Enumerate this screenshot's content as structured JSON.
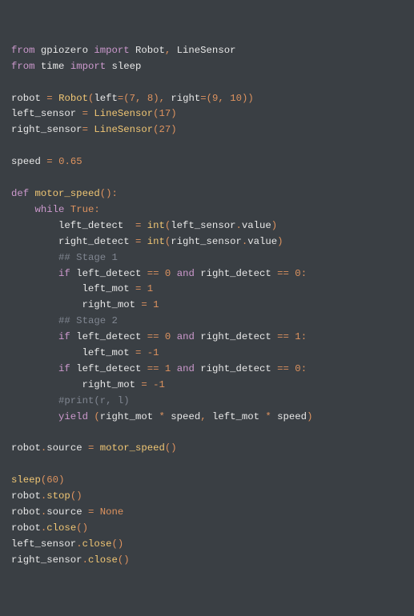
{
  "code": [
    [
      [
        "kw",
        "from"
      ],
      [
        "white",
        " gpiozero "
      ],
      [
        "kw",
        "import"
      ],
      [
        "white",
        " Robot"
      ],
      [
        "num",
        ","
      ],
      [
        "white",
        " LineSensor"
      ]
    ],
    [
      [
        "kw",
        "from"
      ],
      [
        "white",
        " time "
      ],
      [
        "kw",
        "import"
      ],
      [
        "white",
        " sleep"
      ]
    ],
    [
      [
        "",
        ""
      ]
    ],
    [
      [
        "white",
        "robot "
      ],
      [
        "num",
        "="
      ],
      [
        "white",
        " "
      ],
      [
        "fn",
        "Robot"
      ],
      [
        "num",
        "("
      ],
      [
        "white",
        "left"
      ],
      [
        "num",
        "=("
      ],
      [
        "num",
        "7"
      ],
      [
        "num",
        ","
      ],
      [
        "white",
        " "
      ],
      [
        "num",
        "8"
      ],
      [
        "num",
        "),"
      ],
      [
        "white",
        " right"
      ],
      [
        "num",
        "=("
      ],
      [
        "num",
        "9"
      ],
      [
        "num",
        ","
      ],
      [
        "white",
        " "
      ],
      [
        "num",
        "10"
      ],
      [
        "num",
        "))"
      ]
    ],
    [
      [
        "white",
        "left_sensor "
      ],
      [
        "num",
        "="
      ],
      [
        "white",
        " "
      ],
      [
        "fn",
        "LineSensor"
      ],
      [
        "num",
        "("
      ],
      [
        "num",
        "17"
      ],
      [
        "num",
        ")"
      ]
    ],
    [
      [
        "white",
        "right_sensor"
      ],
      [
        "num",
        "="
      ],
      [
        "white",
        " "
      ],
      [
        "fn",
        "LineSensor"
      ],
      [
        "num",
        "("
      ],
      [
        "num",
        "27"
      ],
      [
        "num",
        ")"
      ]
    ],
    [
      [
        "",
        ""
      ]
    ],
    [
      [
        "white",
        "speed "
      ],
      [
        "num",
        "="
      ],
      [
        "white",
        " "
      ],
      [
        "num",
        "0.65"
      ]
    ],
    [
      [
        "",
        ""
      ]
    ],
    [
      [
        "kw",
        "def"
      ],
      [
        "white",
        " "
      ],
      [
        "fn",
        "motor_speed"
      ],
      [
        "num",
        "():"
      ]
    ],
    [
      [
        "white",
        "    "
      ],
      [
        "kw",
        "while"
      ],
      [
        "white",
        " "
      ],
      [
        "num",
        "True"
      ],
      [
        "num",
        ":"
      ]
    ],
    [
      [
        "white",
        "        left_detect  "
      ],
      [
        "num",
        "="
      ],
      [
        "white",
        " "
      ],
      [
        "fn",
        "int"
      ],
      [
        "num",
        "("
      ],
      [
        "white",
        "left_sensor"
      ],
      [
        "num",
        "."
      ],
      [
        "white",
        "value"
      ],
      [
        "num",
        ")"
      ]
    ],
    [
      [
        "white",
        "        right_detect "
      ],
      [
        "num",
        "="
      ],
      [
        "white",
        " "
      ],
      [
        "fn",
        "int"
      ],
      [
        "num",
        "("
      ],
      [
        "white",
        "right_sensor"
      ],
      [
        "num",
        "."
      ],
      [
        "white",
        "value"
      ],
      [
        "num",
        ")"
      ]
    ],
    [
      [
        "white",
        "        "
      ],
      [
        "comment",
        "## Stage 1"
      ]
    ],
    [
      [
        "white",
        "        "
      ],
      [
        "kw",
        "if"
      ],
      [
        "white",
        " left_detect "
      ],
      [
        "num",
        "=="
      ],
      [
        "white",
        " "
      ],
      [
        "num",
        "0"
      ],
      [
        "white",
        " "
      ],
      [
        "kw",
        "and"
      ],
      [
        "white",
        " right_detect "
      ],
      [
        "num",
        "=="
      ],
      [
        "white",
        " "
      ],
      [
        "num",
        "0"
      ],
      [
        "num",
        ":"
      ]
    ],
    [
      [
        "white",
        "            left_mot "
      ],
      [
        "num",
        "="
      ],
      [
        "white",
        " "
      ],
      [
        "num",
        "1"
      ]
    ],
    [
      [
        "white",
        "            right_mot "
      ],
      [
        "num",
        "="
      ],
      [
        "white",
        " "
      ],
      [
        "num",
        "1"
      ]
    ],
    [
      [
        "white",
        "        "
      ],
      [
        "comment",
        "## Stage 2"
      ]
    ],
    [
      [
        "white",
        "        "
      ],
      [
        "kw",
        "if"
      ],
      [
        "white",
        " left_detect "
      ],
      [
        "num",
        "=="
      ],
      [
        "white",
        " "
      ],
      [
        "num",
        "0"
      ],
      [
        "white",
        " "
      ],
      [
        "kw",
        "and"
      ],
      [
        "white",
        " right_detect "
      ],
      [
        "num",
        "=="
      ],
      [
        "white",
        " "
      ],
      [
        "num",
        "1"
      ],
      [
        "num",
        ":"
      ]
    ],
    [
      [
        "white",
        "            left_mot "
      ],
      [
        "num",
        "="
      ],
      [
        "white",
        " "
      ],
      [
        "num",
        "-"
      ],
      [
        "num",
        "1"
      ]
    ],
    [
      [
        "white",
        "        "
      ],
      [
        "kw",
        "if"
      ],
      [
        "white",
        " left_detect "
      ],
      [
        "num",
        "=="
      ],
      [
        "white",
        " "
      ],
      [
        "num",
        "1"
      ],
      [
        "white",
        " "
      ],
      [
        "kw",
        "and"
      ],
      [
        "white",
        " right_detect "
      ],
      [
        "num",
        "=="
      ],
      [
        "white",
        " "
      ],
      [
        "num",
        "0"
      ],
      [
        "num",
        ":"
      ]
    ],
    [
      [
        "white",
        "            right_mot "
      ],
      [
        "num",
        "="
      ],
      [
        "white",
        " "
      ],
      [
        "num",
        "-"
      ],
      [
        "num",
        "1"
      ]
    ],
    [
      [
        "white",
        "        "
      ],
      [
        "comment",
        "#print(r, l)"
      ]
    ],
    [
      [
        "white",
        "        "
      ],
      [
        "kw",
        "yield"
      ],
      [
        "white",
        " "
      ],
      [
        "num",
        "("
      ],
      [
        "white",
        "right_mot "
      ],
      [
        "num",
        "*"
      ],
      [
        "white",
        " speed"
      ],
      [
        "num",
        ","
      ],
      [
        "white",
        " left_mot "
      ],
      [
        "num",
        "*"
      ],
      [
        "white",
        " speed"
      ],
      [
        "num",
        ")"
      ]
    ],
    [
      [
        "",
        ""
      ]
    ],
    [
      [
        "white",
        "robot"
      ],
      [
        "num",
        "."
      ],
      [
        "white",
        "source "
      ],
      [
        "num",
        "="
      ],
      [
        "white",
        " "
      ],
      [
        "fn",
        "motor_speed"
      ],
      [
        "num",
        "()"
      ]
    ],
    [
      [
        "",
        ""
      ]
    ],
    [
      [
        "fn",
        "sleep"
      ],
      [
        "num",
        "("
      ],
      [
        "num",
        "60"
      ],
      [
        "num",
        ")"
      ]
    ],
    [
      [
        "white",
        "robot"
      ],
      [
        "num",
        "."
      ],
      [
        "fn",
        "stop"
      ],
      [
        "num",
        "()"
      ]
    ],
    [
      [
        "white",
        "robot"
      ],
      [
        "num",
        "."
      ],
      [
        "white",
        "source "
      ],
      [
        "num",
        "="
      ],
      [
        "white",
        " "
      ],
      [
        "num",
        "None"
      ]
    ],
    [
      [
        "white",
        "robot"
      ],
      [
        "num",
        "."
      ],
      [
        "fn",
        "close"
      ],
      [
        "num",
        "()"
      ]
    ],
    [
      [
        "white",
        "left_sensor"
      ],
      [
        "num",
        "."
      ],
      [
        "fn",
        "close"
      ],
      [
        "num",
        "()"
      ]
    ],
    [
      [
        "white",
        "right_sensor"
      ],
      [
        "num",
        "."
      ],
      [
        "fn",
        "close"
      ],
      [
        "num",
        "()"
      ]
    ]
  ]
}
